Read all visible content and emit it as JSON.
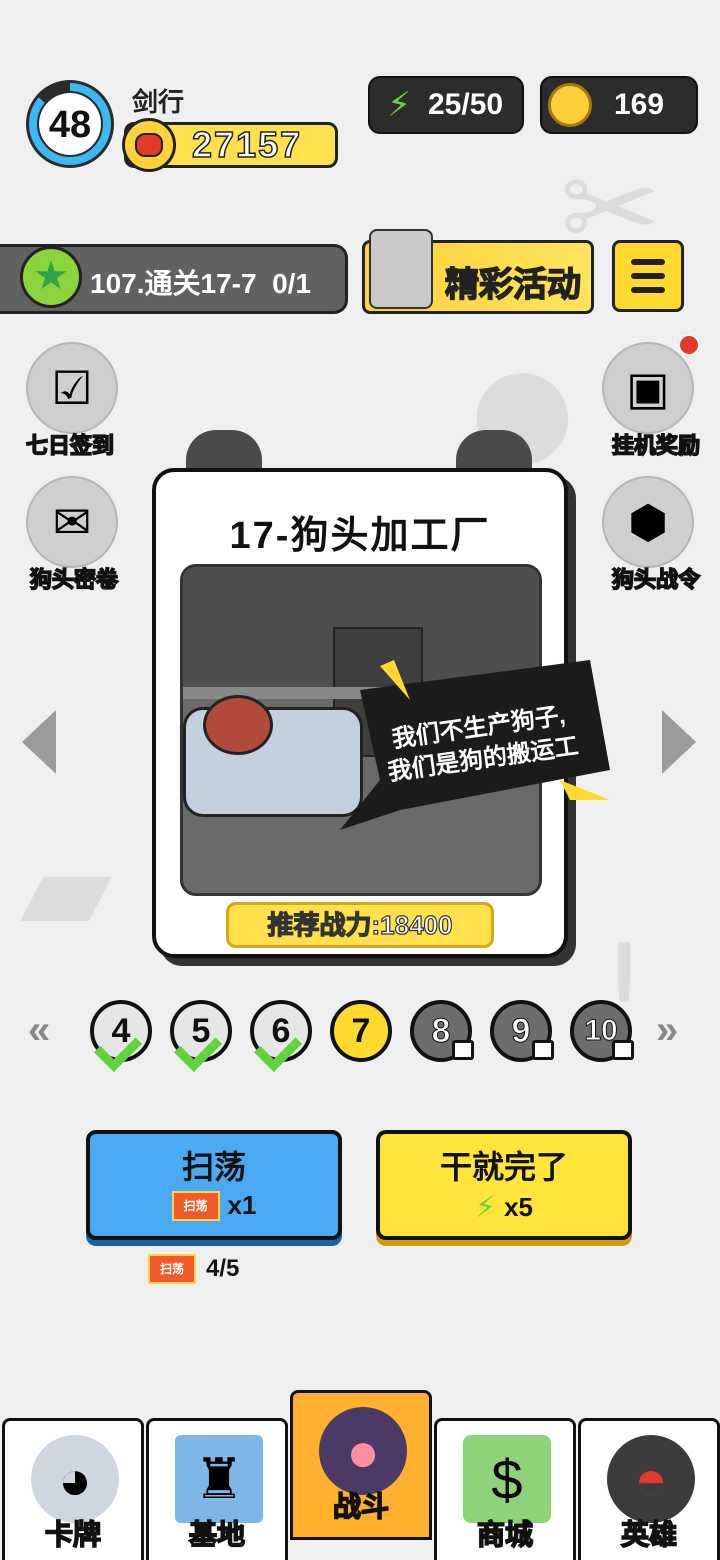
{
  "player": {
    "level": "48",
    "name": "剑行",
    "power": "27157"
  },
  "resources": {
    "energy": "25/50",
    "coins": "169"
  },
  "stage_progress": {
    "text": "107.通关17-7",
    "count": "0/1"
  },
  "event_banner": {
    "label": "精彩活动"
  },
  "side_buttons": {
    "checkin": "七日签到",
    "secret": "狗头密卷",
    "idle_reward": "挂机奖励",
    "battle_pass": "狗头战令"
  },
  "stage_card": {
    "title": "17-狗头加工厂",
    "speech_line1": "我们不生产狗子,",
    "speech_line2": "我们是狗的搬运工",
    "recommended_power": "推荐战力:18400"
  },
  "levels": [
    {
      "num": "4",
      "state": "done"
    },
    {
      "num": "5",
      "state": "done"
    },
    {
      "num": "6",
      "state": "done"
    },
    {
      "num": "7",
      "state": "current"
    },
    {
      "num": "8",
      "state": "locked"
    },
    {
      "num": "9",
      "state": "locked"
    },
    {
      "num": "10",
      "state": "locked"
    }
  ],
  "level_nav": {
    "prev": "«",
    "next": "»"
  },
  "actions": {
    "sweep_label": "扫荡",
    "sweep_ticket": "扫荡",
    "sweep_cost": "x1",
    "go_label": "干就完了",
    "go_cost": "x5",
    "ticket_label": "扫荡",
    "ticket_count": "4/5"
  },
  "nav": {
    "cards": "卡牌",
    "base": "基地",
    "battle": "战斗",
    "shop": "商城",
    "heroes": "英雄"
  },
  "colors": {
    "accent_yellow": "#ffd92e",
    "sweep_blue": "#49a9f2",
    "energy_green": "#6ad43c",
    "active_tab": "#ffb02e"
  }
}
